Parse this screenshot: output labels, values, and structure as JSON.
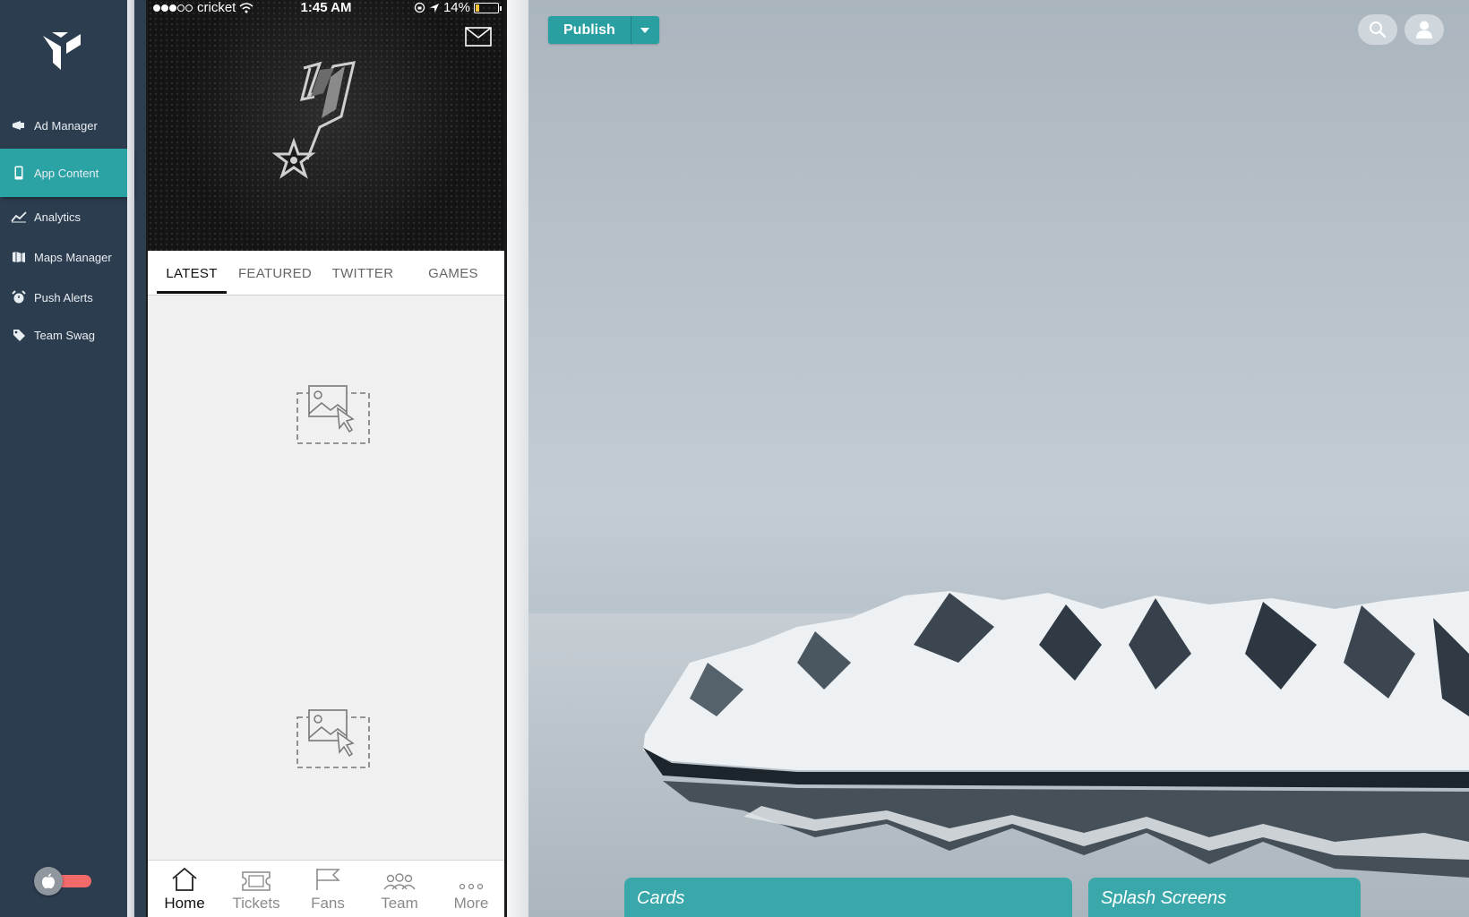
{
  "sidebar": {
    "logo_icon": "brand-logo-icon",
    "items": [
      {
        "label": "Ad Manager",
        "icon": "megaphone-icon"
      },
      {
        "label": "App Content",
        "icon": "mobile-icon",
        "active": true
      },
      {
        "label": "Analytics",
        "icon": "chart-line-icon"
      },
      {
        "label": "Maps Manager",
        "icon": "map-icon"
      },
      {
        "label": "Push Alerts",
        "icon": "alarm-icon"
      },
      {
        "label": "Team Swag",
        "icon": "tag-icon"
      }
    ],
    "platform_toggle": {
      "icon": "apple-icon",
      "accent": "#f26a6a"
    }
  },
  "phone": {
    "status": {
      "carrier": "cricket",
      "time": "1:45 AM",
      "battery": "14%"
    },
    "tabs": [
      {
        "label": "LATEST",
        "active": true
      },
      {
        "label": "FEATURED"
      },
      {
        "label": "TWITTER"
      },
      {
        "label": "GAMES"
      }
    ],
    "bottom_nav": [
      {
        "label": "Home",
        "icon": "home-icon",
        "active": true
      },
      {
        "label": "Tickets",
        "icon": "ticket-icon"
      },
      {
        "label": "Fans",
        "icon": "flag-icon"
      },
      {
        "label": "Team",
        "icon": "group-icon"
      },
      {
        "label": "More",
        "icon": "more-dots-icon"
      }
    ]
  },
  "toolbar": {
    "publish_label": "Publish",
    "accent": "#2a9fa2"
  },
  "panels": [
    {
      "label": "Cards"
    },
    {
      "label": "Splash Screens"
    }
  ],
  "colors": {
    "sidebar_bg": "#2d3d50",
    "active_item": "#2ba3a5",
    "panel_tab": "#3aa8aa"
  }
}
